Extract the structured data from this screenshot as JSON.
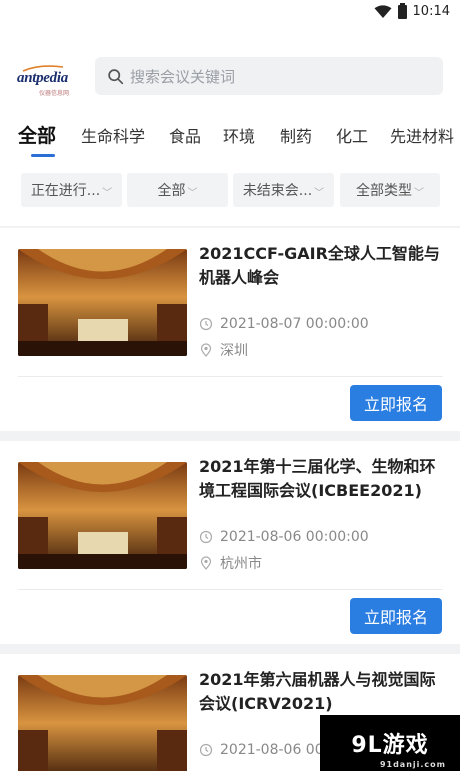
{
  "status_bar": {
    "time": "10:14",
    "icons": [
      "wifi-icon",
      "battery-icon"
    ]
  },
  "header": {
    "logo": {
      "text_main": "antpedia",
      "text_sub": "仪器信息网"
    },
    "search": {
      "placeholder": "搜索会议关键词",
      "icon": "search-icon"
    }
  },
  "tabs": [
    "全部",
    "生命科学",
    "食品",
    "环境",
    "制药",
    "化工",
    "先进材料"
  ],
  "active_tab": 0,
  "filters": [
    {
      "label": "正在进行...",
      "icon": "chevron-down-icon"
    },
    {
      "label": "全部",
      "icon": "chevron-down-icon"
    },
    {
      "label": "未结束会...",
      "icon": "chevron-down-icon"
    },
    {
      "label": "全部类型",
      "icon": "chevron-down-icon"
    }
  ],
  "conferences": [
    {
      "title": "2021CCF-GAIR全球人工智能与机器人峰会",
      "datetime": "2021-08-07 00:00:00",
      "location": "深圳",
      "button": "立即报名"
    },
    {
      "title": "2021年第十三届化学、生物和环境工程国际会议(ICBEE2021)",
      "datetime": "2021-08-06 00:00:00",
      "location": "杭州市",
      "button": "立即报名"
    },
    {
      "title": "2021年第六届机器人与视觉国际会议(ICRV2021)",
      "datetime": "2021-08-06 00:00:00",
      "location": "",
      "button": ""
    }
  ],
  "watermark": {
    "brand": "9L游戏",
    "url": "91danji.com"
  },
  "colors": {
    "accent": "#2a7de1",
    "tab_underline": "#2a6fd6",
    "page_bg": "#f1f2f4"
  }
}
